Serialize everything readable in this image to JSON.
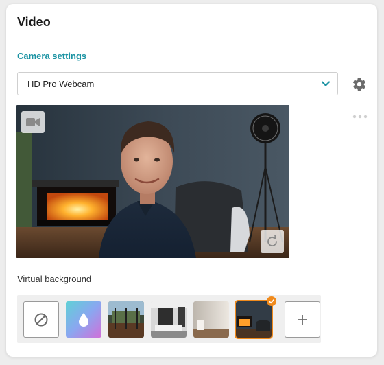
{
  "panel": {
    "title": "Video",
    "camera_settings_label": "Camera settings"
  },
  "camera_select": {
    "selected_value": "HD Pro Webcam",
    "icon": "chevron-down-icon"
  },
  "icons": {
    "settings": "gear-icon",
    "more": "more-horizontal-icon",
    "camera": "video-camera-icon",
    "rotate": "rotate-icon",
    "none": "no-background-icon",
    "add": "plus-icon",
    "selected_check": "check-icon"
  },
  "virtual_background": {
    "label": "Virtual background",
    "options": [
      {
        "kind": "none"
      },
      {
        "kind": "blur"
      },
      {
        "kind": "image",
        "scene": "balcony"
      },
      {
        "kind": "image",
        "scene": "living-room"
      },
      {
        "kind": "image",
        "scene": "white-wall"
      },
      {
        "kind": "image",
        "scene": "fireplace",
        "selected": true
      },
      {
        "kind": "add"
      }
    ]
  },
  "colors": {
    "accent": "#1b93a3",
    "selected": "#f08a1c"
  }
}
